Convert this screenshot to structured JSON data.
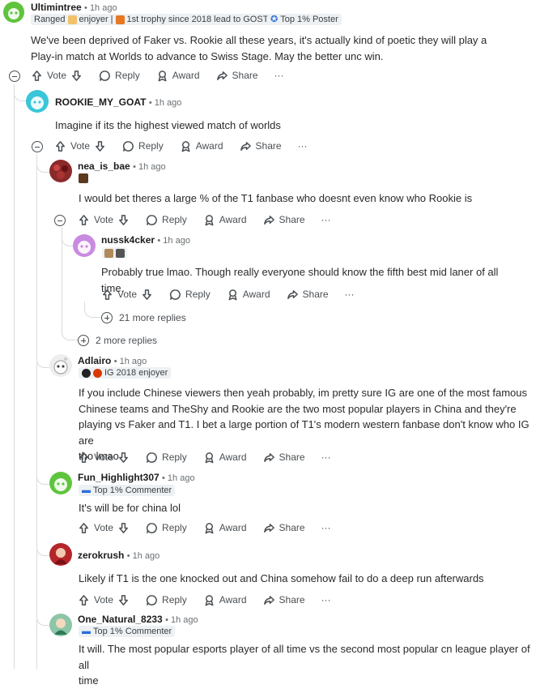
{
  "actions": {
    "vote": "Vote",
    "reply": "Reply",
    "award": "Award",
    "share": "Share",
    "more": "···"
  },
  "colors": {
    "accent": "#d93900",
    "muted": "#6a6f73",
    "thread_line": "#d8dbde"
  },
  "comments": [
    {
      "user": "Ultimintree",
      "time": "• 1h ago",
      "avatar_color": "#5fc43d",
      "flair": [
        "Ranged",
        "enjoyer |",
        "1st trophy since 2018 lead to GOST"
      ],
      "extra_flair": "Top 1% Poster",
      "body": "We've been deprived of Faker vs. Rookie all these years, it's actually kind of poetic they will play a Play-in match at Worlds to advance to Swiss Stage. May the better unc win."
    },
    {
      "user": "ROOKIE_MY_GOAT",
      "time": "• 1h ago",
      "avatar_color": "#38c6d8",
      "body": "Imagine if its the highest viewed match of worlds"
    },
    {
      "user": "nea_is_bae",
      "time": "• 1h ago",
      "avatar_color": "#8a2a2a",
      "body": "I would bet theres a large % of the T1 fanbase who doesnt even know who Rookie is"
    },
    {
      "user": "nussk4cker",
      "time": "• 1h ago",
      "avatar_color": "#c98be0",
      "body": "Probably true lmao. Though really everyone should know the fifth best mid laner of all time."
    },
    {
      "user": "Adlairo",
      "time": "• 1h ago",
      "avatar_color": "#eeeeee",
      "flair": "IG 2018 enjoyer",
      "body": [
        "If you include Chinese viewers then yeah probably, im pretty sure IG are one of the most famous",
        "Chinese teams and TheShy and Rookie are the two most popular players in China and they're",
        "playing vs Faker and T1. I bet a large portion of T1's modern western fanbase don't know who IG are",
        "tho lmao"
      ]
    },
    {
      "user": "Fun_Highlight307",
      "time": "• 1h ago",
      "avatar_color": "#5fc43d",
      "flair": "Top 1% Commenter",
      "body": "It's will be for china lol"
    },
    {
      "user": "zerokrush",
      "time": "• 1h ago",
      "avatar_color": "#b5262b",
      "body": "Likely if T1 is the one knocked out and China somehow fail to do a deep run afterwards"
    },
    {
      "user": "One_Natural_8233",
      "time": "• 1h ago",
      "avatar_color": "#8cc6a6",
      "flair": "Top 1% Commenter",
      "body": [
        "It will. The most popular esports player of all time vs the second most popular cn league player of all",
        "time"
      ]
    }
  ],
  "more_replies": [
    "21 more replies",
    "2 more replies"
  ]
}
